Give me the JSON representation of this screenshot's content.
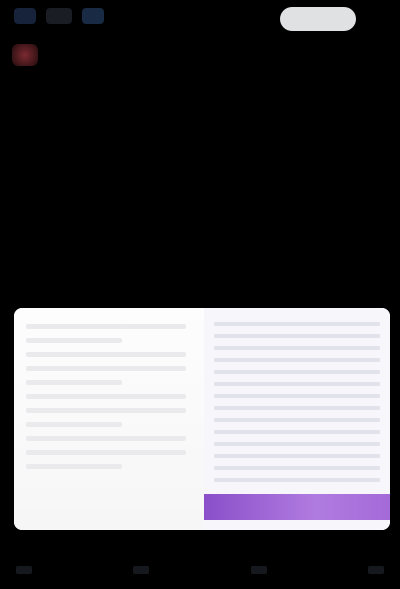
{
  "header": {
    "icons": [
      "back-icon",
      "profile-icon",
      "notification-icon"
    ],
    "action_label": ""
  },
  "post": {
    "author_meta": "",
    "paragraphs": [
      "",
      "",
      ""
    ],
    "mention": ""
  },
  "media": {
    "banner_text": ""
  },
  "footer": {
    "meta": "",
    "actions": [
      "reply-icon",
      "repost-icon",
      "like-icon",
      "share-icon"
    ]
  },
  "colors": {
    "background": "#000000",
    "button": "#dfe1e3",
    "banner": "#8a4fc9",
    "link": "#1d9bf0"
  }
}
